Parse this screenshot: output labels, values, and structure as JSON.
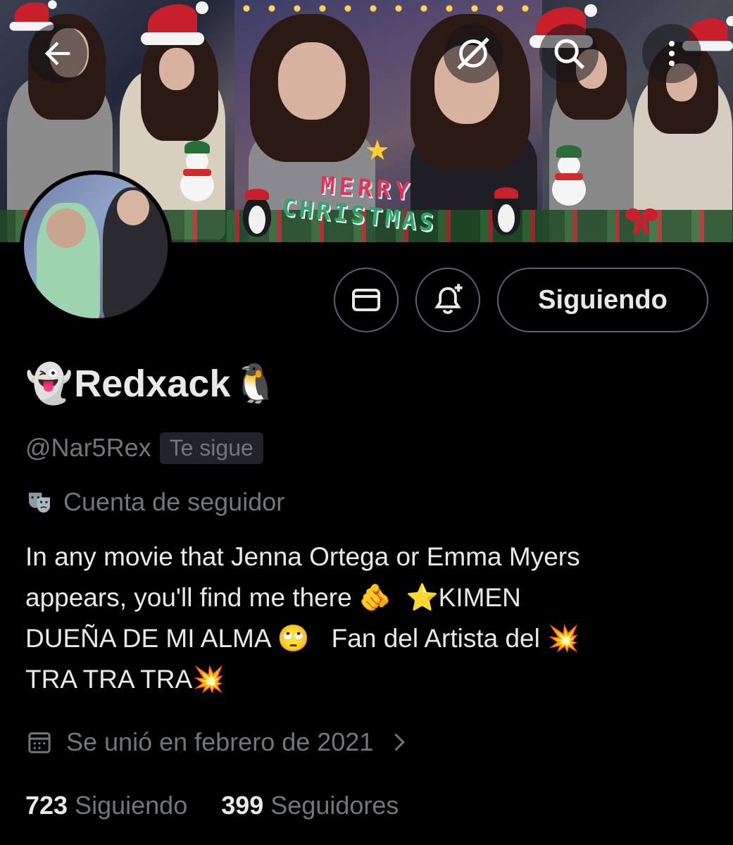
{
  "banner": {
    "greeting_line1": "MERRY",
    "greeting_line2": "CHRISTMAS"
  },
  "nav": {
    "back_icon": "arrow-left-icon",
    "grok_icon": "grok-icon",
    "search_icon": "search-icon",
    "more_icon": "more-vertical-icon"
  },
  "actions": {
    "message_icon": "envelope-icon",
    "notify_icon": "bell-plus-icon",
    "follow_label": "Siguiendo"
  },
  "profile": {
    "name_prefix_emoji": "👻",
    "name": "Redxack",
    "name_suffix_emoji": "🐧",
    "handle": "@Nar5Rex",
    "follows_you": "Te sigue",
    "category_icon": "masks-icon",
    "category": "Cuenta de seguidor",
    "bio": "In any movie that Jenna Ortega or Emma Myers\nappears, you'll find me there 🫵  ⭐KIMEN\nDUEÑA DE MI ALMA 🙄   Fan del Artista del 💥\nTRA TRA TRA💥",
    "joined_icon": "calendar-icon",
    "joined": "Se unió en febrero de 2021",
    "following_count": "723",
    "following_label": "Siguiendo",
    "followers_count": "399",
    "followers_label": "Seguidores"
  },
  "colors": {
    "background": "#000000",
    "primary_text": "#e7e9ea",
    "secondary_text": "#71767b",
    "border": "#536471",
    "chip_bg": "#202327"
  }
}
